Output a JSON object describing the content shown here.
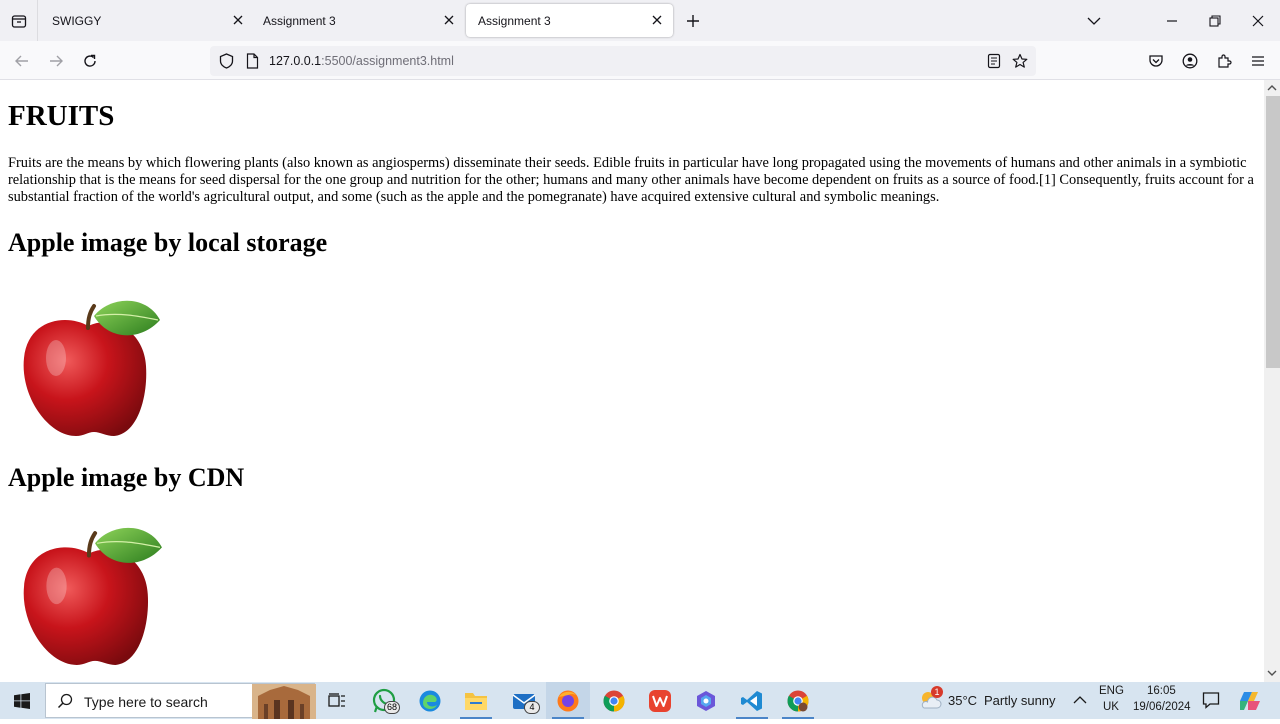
{
  "browser": {
    "tabs": [
      {
        "label": "SWIGGY",
        "active": false
      },
      {
        "label": "Assignment 3",
        "active": false
      },
      {
        "label": "Assignment 3",
        "active": true
      }
    ],
    "url_host": "127.0.0.1",
    "url_path": ":5500/assignment3.html"
  },
  "page": {
    "title": "FRUITS",
    "intro": "Fruits are the means by which flowering plants (also known as angiosperms) disseminate their seeds. Edible fruits in particular have long propagated using the movements of humans and other animals in a symbiotic relationship that is the means for seed dispersal for the one group and nutrition for the other; humans and many other animals have become dependent on fruits as a source of food.[1] Consequently, fruits account for a substantial fraction of the world's agricultural output, and some (such as the apple and the pomegranate) have acquired extensive cultural and symbolic meanings.",
    "section_local": "Apple image by local storage",
    "section_cdn": "Apple image by CDN"
  },
  "taskbar": {
    "search_placeholder": "Type here to search",
    "whatsapp_badge": "68",
    "mail_badge": "4",
    "weather_badge": "1",
    "temperature": "35°C",
    "weather": "Partly sunny",
    "lang_line1": "ENG",
    "lang_line2": "UK",
    "time": "16:05",
    "date": "19/06/2024"
  },
  "colors": {
    "accent": "#4b85c8",
    "apple_red": "#c8141b",
    "leaf_green": "#3f9e2a"
  }
}
